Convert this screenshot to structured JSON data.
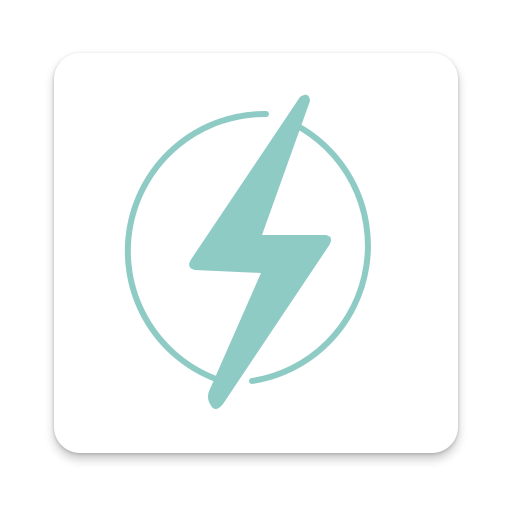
{
  "app_icon": {
    "icon": "lightning-bolt-in-circle-icon",
    "colors": {
      "tile_background": "#ffffff",
      "accent": "#8ecbc4"
    }
  }
}
